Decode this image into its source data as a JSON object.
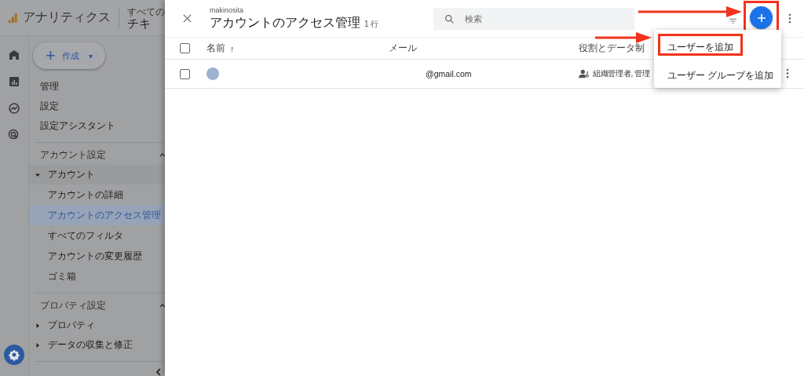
{
  "app": {
    "name": "アナリティクス",
    "breadcrumb": "すべての",
    "property": "チキ"
  },
  "rail": [
    {
      "kind": "home"
    },
    {
      "kind": "reports"
    },
    {
      "kind": "explore"
    },
    {
      "kind": "advertising"
    }
  ],
  "create_button": {
    "icon": "+",
    "label": "作成",
    "caret": "▾"
  },
  "nav": {
    "items": [
      {
        "label": "管理"
      },
      {
        "label": "設定"
      },
      {
        "label": "設定アシスタント"
      }
    ],
    "sections": [
      {
        "title": "アカウント設定",
        "expanded": true,
        "groups": [
          {
            "label": "アカウント",
            "expanded": true,
            "children": [
              {
                "label": "アカウントの詳細",
                "selected": false
              },
              {
                "label": "アカウントのアクセス管理",
                "selected": true
              },
              {
                "label": "すべてのフィルタ",
                "selected": false
              },
              {
                "label": "アカウントの変更履歴",
                "selected": false
              },
              {
                "label": "ゴミ箱",
                "selected": false
              }
            ]
          }
        ]
      },
      {
        "title": "プロパティ設定",
        "expanded": true,
        "groups": [
          {
            "label": "プロパティ",
            "expanded": false
          },
          {
            "label": "データの収集と修正",
            "expanded": false
          }
        ]
      }
    ]
  },
  "panel": {
    "account": "makinosita",
    "title": "アカウントのアクセス管理",
    "count": "1 行",
    "search": {
      "placeholder": "検索"
    },
    "add_button": {
      "highlighted": true
    },
    "menu": {
      "items": [
        {
          "label": "ユーザーを追加",
          "highlighted": true
        },
        {
          "label": "ユーザー グループを追加",
          "highlighted": false
        }
      ]
    },
    "table": {
      "checked": false,
      "columns": [
        {
          "label": "名前",
          "sort_arrow": "↑"
        },
        {
          "label": "メール"
        },
        {
          "label": "役割とデータ制"
        }
      ],
      "rows": [
        {
          "selected": false,
          "email": "@gmail.com",
          "roles": "組織管理者, 管理"
        }
      ]
    }
  }
}
